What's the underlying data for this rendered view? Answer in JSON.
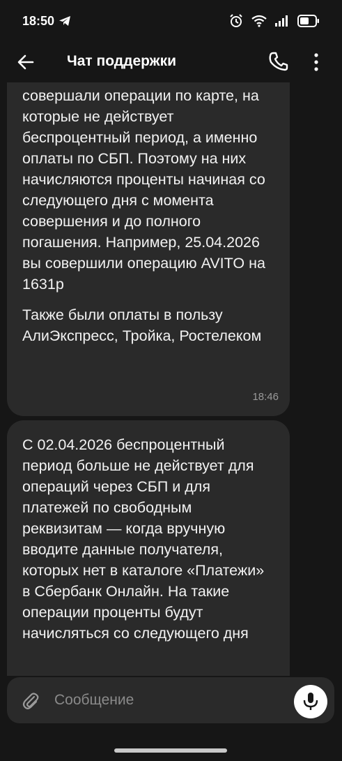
{
  "status_bar": {
    "time": "18:50",
    "icons": [
      "telegram-icon",
      "alarm-icon",
      "wifi-icon",
      "signal-icon",
      "battery-icon"
    ]
  },
  "header": {
    "title": "Чат поддержки",
    "icons": [
      "back-arrow-icon",
      "phone-icon",
      "more-vert-icon"
    ]
  },
  "messages": [
    {
      "paragraphs": [
        "совершали операции по карте, на которые не действует беспроцентный период, а именно оплаты по СБП. Поэтому на них начисляются проценты начиная со следующего дня с момента совершения и до полного погашения. Например, 25.04.2026 вы совершили операцию AVITO на 1631р",
        "Также были оплаты в пользу АлиЭкспресс, Тройка, Ростелеком"
      ],
      "time": "18:46"
    },
    {
      "paragraphs": [
        "С 02.04.2026 беспроцентный период больше не действует для операций через СБП и для платежей по свободным реквизитам — когда вручную вводите данные получателя, которых нет в каталоге «Платежи» в Сбербанк Онлайн. На такие операции проценты будут начисляться со следующего дня"
      ]
    }
  ],
  "composer": {
    "placeholder": "Сообщение",
    "icons": [
      "attach-icon",
      "mic-icon"
    ]
  },
  "colors": {
    "background": "#161616",
    "bubble": "#2a2a2a",
    "text": "#f2f2f2",
    "muted": "#9a9a9a"
  }
}
